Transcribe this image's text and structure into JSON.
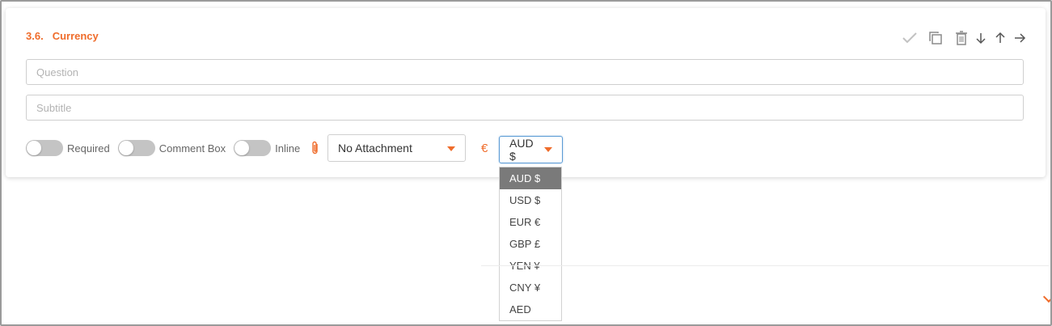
{
  "section": {
    "number": "3.6.",
    "title": "Currency"
  },
  "toolbar": {
    "icons": [
      "check-icon",
      "copy-icon",
      "trash-icon",
      "arrow-down-icon",
      "arrow-up-icon",
      "arrow-right-icon"
    ]
  },
  "question": {
    "placeholder": "Question",
    "value": ""
  },
  "subtitle": {
    "placeholder": "Subtitle",
    "value": ""
  },
  "toggles": [
    {
      "label": "Required",
      "on": false
    },
    {
      "label": "Comment Box",
      "on": false
    },
    {
      "label": "Inline",
      "on": false
    }
  ],
  "attachment": {
    "selected": "No Attachment"
  },
  "currency": {
    "symbol": "€",
    "selected": "AUD $",
    "options": [
      "AUD $",
      "USD $",
      "EUR €",
      "GBP £",
      "YEN ¥",
      "CNY ¥",
      "AED"
    ]
  },
  "colors": {
    "accent": "#ef6c2b",
    "focus_border": "#5b9bd5",
    "selected_option_bg": "#7a7a7a"
  }
}
